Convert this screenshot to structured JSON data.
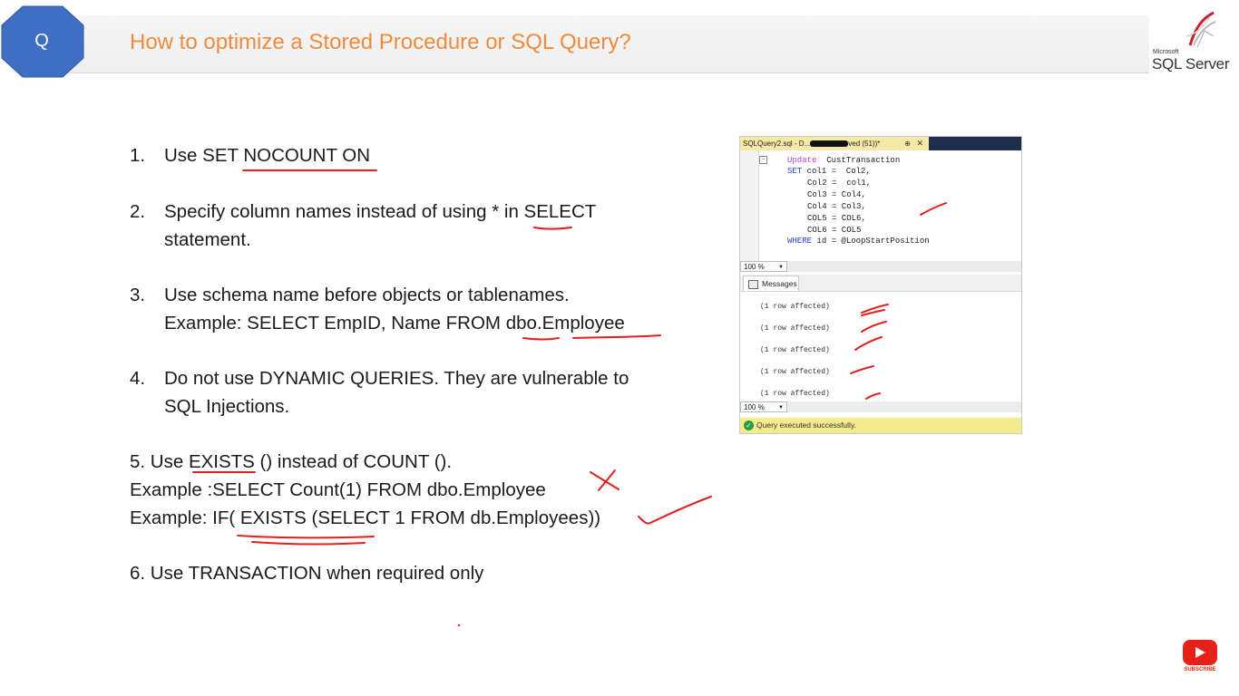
{
  "header": {
    "badge_letter": "Q",
    "title": "How to optimize a Stored Procedure or SQL Query?",
    "logo_small": "Microsoft",
    "logo_name": "SQL Server",
    "accent_color": "#f08a3c",
    "badge_color": "#3e6fc4"
  },
  "tips": [
    {
      "num": "1.",
      "lines": [
        "Use SET NOCOUNT ON"
      ]
    },
    {
      "num": "2.",
      "lines": [
        "Specify column names instead of using * in SELECT",
        "statement."
      ]
    },
    {
      "num": "3.",
      "lines": [
        "Use schema name before objects or tablenames.",
        "Example: SELECT EmpID, Name FROM dbo.Employee"
      ]
    },
    {
      "num": "4.",
      "lines": [
        "Do not use DYNAMIC QUERIES. They are vulnerable to",
        "SQL Injections."
      ]
    }
  ],
  "tip5": [
    "5. Use EXISTS () instead of COUNT ().",
    "Example :SELECT Count(1) FROM dbo.Employee",
    "Example: IF( EXISTS (SELECT 1 FROM db.Employees))"
  ],
  "tip6": "6.  Use TRANSACTION when required only",
  "ssms": {
    "tab_title_start": "SQLQuery2.sql - D...",
    "tab_title_end": "ved (51))*",
    "pin": "⊕",
    "close": "✕",
    "code": [
      {
        "kw": "Update",
        "rest": "  CustTransaction"
      },
      {
        "kw": "SET",
        "rest": " col1 =  Col2,"
      },
      {
        "kw": "",
        "rest": "Col2 =  col1,"
      },
      {
        "kw": "",
        "rest": "Col3 = Col4,"
      },
      {
        "kw": "",
        "rest": "Col4 = Col3,"
      },
      {
        "kw": "",
        "rest": "COL5 = COL6,"
      },
      {
        "kw": "",
        "rest": "COL6 = COL5"
      },
      {
        "kw": "WHERE",
        "rest": " id = @LoopStartPosition"
      }
    ],
    "zoom1": "100 %",
    "zoom2": "100 %",
    "messages_tab": "Messages",
    "messages": [
      "(1 row affected)",
      "(1 row affected)",
      "(1 row affected)",
      "(1 row affected)",
      "(1 row affected)"
    ],
    "status": "Query executed successfully."
  },
  "youtube": {
    "label": "SUBSCRIBE"
  }
}
